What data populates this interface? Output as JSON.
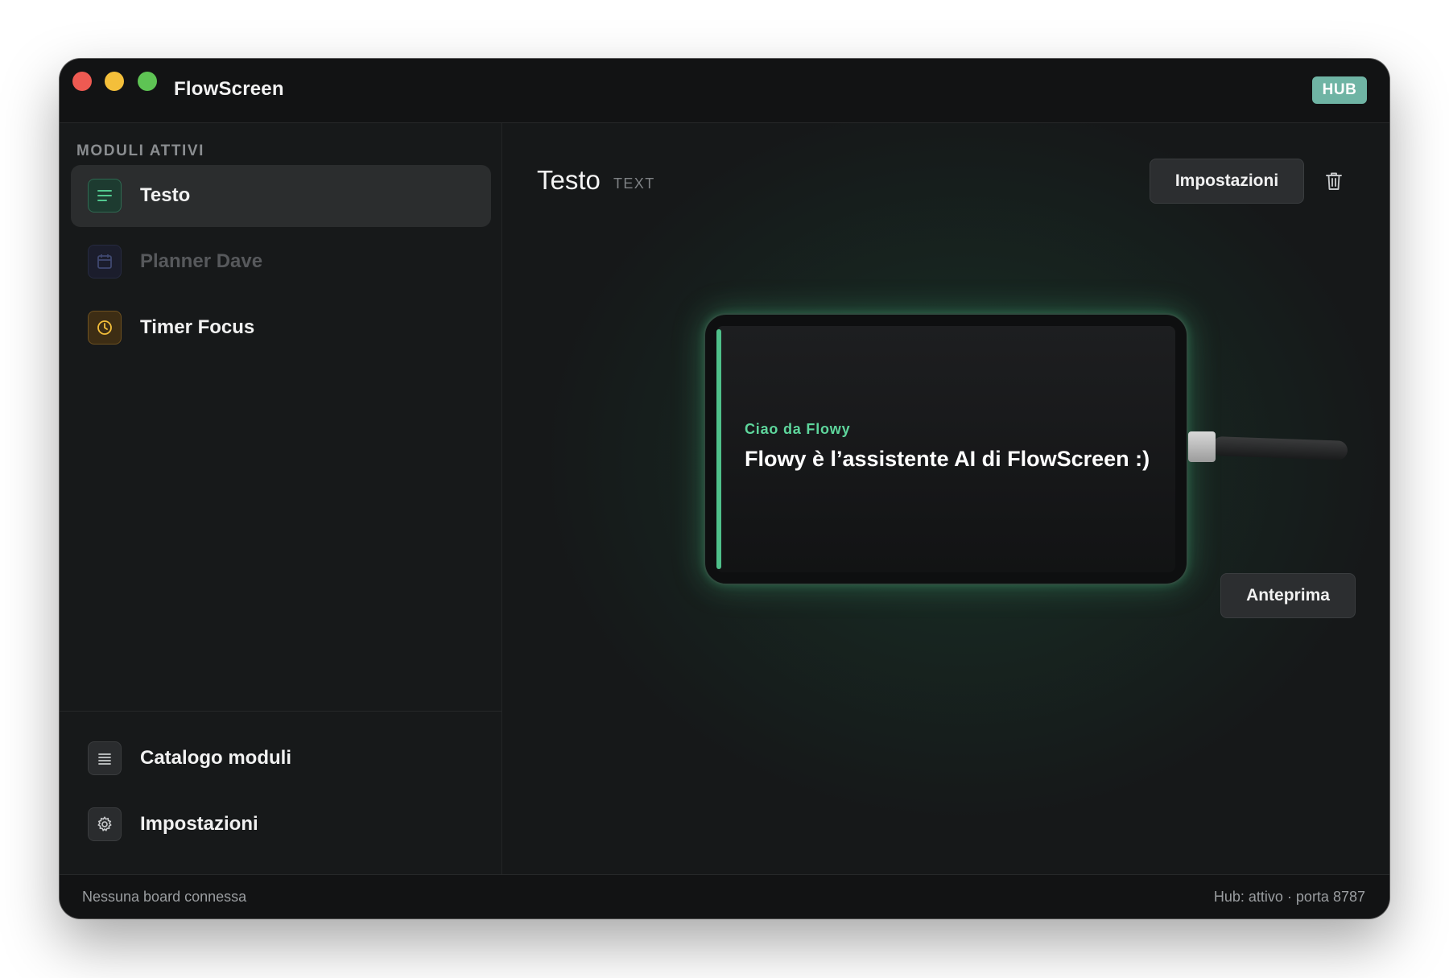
{
  "app": {
    "title": "FlowScreen",
    "badge": "HUB"
  },
  "sidebar": {
    "section_label": "MODULI ATTIVI",
    "items": [
      {
        "label": "Testo",
        "icon": "text-lines-icon",
        "state": "active"
      },
      {
        "label": "Planner Dave",
        "icon": "calendar-icon",
        "state": "disabled"
      },
      {
        "label": "Timer Focus",
        "icon": "clock-icon",
        "state": "normal"
      }
    ],
    "footer_items": [
      {
        "label": "Catalogo moduli",
        "icon": "list-icon"
      },
      {
        "label": "Impostazioni",
        "icon": "gear-icon"
      }
    ]
  },
  "main": {
    "title": "Testo",
    "type": "TEXT",
    "settings_button": "Impostazioni",
    "preview_button": "Anteprima",
    "device": {
      "screen_title": "Ciao da Flowy",
      "screen_text": "Flowy è l’assistente AI di FlowScreen :)"
    }
  },
  "statusbar": {
    "left": "Nessuna board connessa",
    "right": "Hub: attivo · porta 8787"
  },
  "colors": {
    "accent_green": "#4fc08a",
    "hub_badge": "#6fb4a4",
    "timer_amber": "#f4bf3a"
  }
}
